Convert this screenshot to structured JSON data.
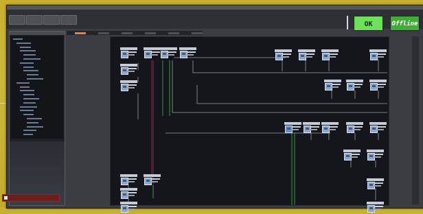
{
  "window": {
    "title": ""
  },
  "toolbar": {
    "buttons": [
      "",
      "",
      "",
      ""
    ]
  },
  "status": {
    "primary": {
      "label": "",
      "value": "OK",
      "color": "#6ee05a"
    },
    "secondary": {
      "label": "",
      "value": "Offline",
      "color": "#3fae35"
    }
  },
  "sidebar": {
    "tree_levels": [
      0,
      1,
      2,
      2,
      3,
      3,
      2,
      3,
      3,
      4,
      4,
      1,
      2,
      2,
      3,
      3,
      3,
      2,
      2,
      3,
      4,
      4,
      4,
      3,
      3
    ],
    "bottom_tab": ""
  },
  "tabs": [
    "",
    "",
    "",
    "",
    "",
    ""
  ],
  "colors": {
    "accent_tab": "#ff7a3a",
    "wire_green": "#3fbf3f",
    "wire_red": "#a0305a",
    "wire_gray": "#9aa0aa"
  }
}
